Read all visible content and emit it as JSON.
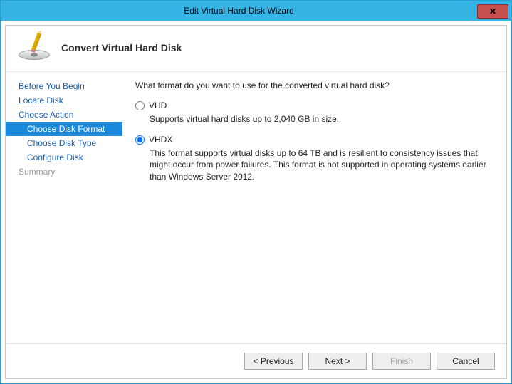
{
  "window": {
    "title": "Edit Virtual Hard Disk Wizard"
  },
  "header": {
    "title": "Convert Virtual Hard Disk"
  },
  "sidebar": {
    "items": [
      {
        "label": "Before You Begin",
        "sub": false,
        "selected": false,
        "disabled": false
      },
      {
        "label": "Locate Disk",
        "sub": false,
        "selected": false,
        "disabled": false
      },
      {
        "label": "Choose Action",
        "sub": false,
        "selected": false,
        "disabled": false
      },
      {
        "label": "Choose Disk Format",
        "sub": true,
        "selected": true,
        "disabled": false
      },
      {
        "label": "Choose Disk Type",
        "sub": true,
        "selected": false,
        "disabled": false
      },
      {
        "label": "Configure Disk",
        "sub": true,
        "selected": false,
        "disabled": false
      },
      {
        "label": "Summary",
        "sub": false,
        "selected": false,
        "disabled": true
      }
    ]
  },
  "content": {
    "question": "What format do you want to use for the converted virtual hard disk?",
    "options": [
      {
        "value": "vhd",
        "label": "VHD",
        "description": "Supports virtual hard disks up to 2,040 GB in size.",
        "checked": false
      },
      {
        "value": "vhdx",
        "label": "VHDX",
        "description": "This format supports virtual disks up to 64 TB and is resilient to consistency issues that might occur from power failures. This format is not supported in operating systems earlier than Windows Server 2012.",
        "checked": true
      }
    ]
  },
  "buttons": {
    "previous": "< Previous",
    "next": "Next >",
    "finish": "Finish",
    "cancel": "Cancel"
  }
}
